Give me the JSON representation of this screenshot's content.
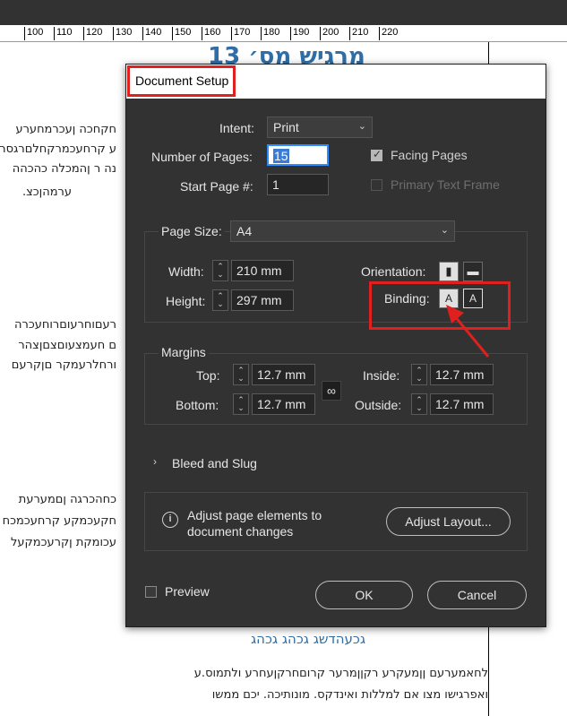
{
  "ruler": {
    "ticks": [
      "100",
      "110",
      "120",
      "130",
      "140",
      "150",
      "160",
      "170",
      "180",
      "190",
      "200",
      "210",
      "220"
    ]
  },
  "document": {
    "heading": "מרגיש מס׳ 13",
    "lines": [
      "חקחכה ןעכרמחערע",
      "ע קרחעכמרקחלםרגסר",
      "נה ר ןהמכלה כהכהה",
      "ערמהןכצ.",
      "רעםוחרעוםרוחעכרה",
      "ם חעמצעוםצםןצהר",
      "ורחלרעמקר םןקרעם",
      "כחהכרגה ןםמערעת",
      "חקעכמקע קרחעכמכח",
      "עכומקת ןקרעכמקעל"
    ],
    "subheading": "גכעהדשג גכהג גכהג",
    "bottom_lines": [
      "לחאמערעם ןןמעקרע רקןןמרער קרוםחרקןעחרע ולתמוס.ע",
      "ואפרגישו מצו אם למללות ואינדקס. מונותיכה. יכם ממשו"
    ]
  },
  "dialog": {
    "title": "Document Setup",
    "intent": {
      "label": "Intent:",
      "value": "Print"
    },
    "num_pages": {
      "label": "Number of Pages:",
      "value": "15"
    },
    "start_page": {
      "label": "Start Page #:",
      "value": "1"
    },
    "facing_pages": {
      "label": "Facing Pages",
      "checked": true
    },
    "primary_text_frame": {
      "label": "Primary Text Frame",
      "checked": false
    },
    "page_size": {
      "label": "Page Size:",
      "value": "A4"
    },
    "width": {
      "label": "Width:",
      "value": "210 mm"
    },
    "height": {
      "label": "Height:",
      "value": "297 mm"
    },
    "orientation": {
      "label": "Orientation:"
    },
    "binding": {
      "label": "Binding:"
    },
    "margins": {
      "label": "Margins",
      "top": {
        "label": "Top:",
        "value": "12.7 mm"
      },
      "bottom": {
        "label": "Bottom:",
        "value": "12.7 mm"
      },
      "inside": {
        "label": "Inside:",
        "value": "12.7 mm"
      },
      "outside": {
        "label": "Outside:",
        "value": "12.7 mm"
      }
    },
    "bleed_slug": {
      "label": "Bleed and Slug"
    },
    "info": {
      "line1": "Adjust page elements to",
      "line2": "document changes"
    },
    "adjust_layout": "Adjust Layout...",
    "preview": {
      "label": "Preview",
      "checked": false
    },
    "ok": "OK",
    "cancel": "Cancel"
  },
  "colors": {
    "highlight": "#e0201e",
    "dialog_bg": "#323232",
    "heading": "#2f6ea6"
  }
}
